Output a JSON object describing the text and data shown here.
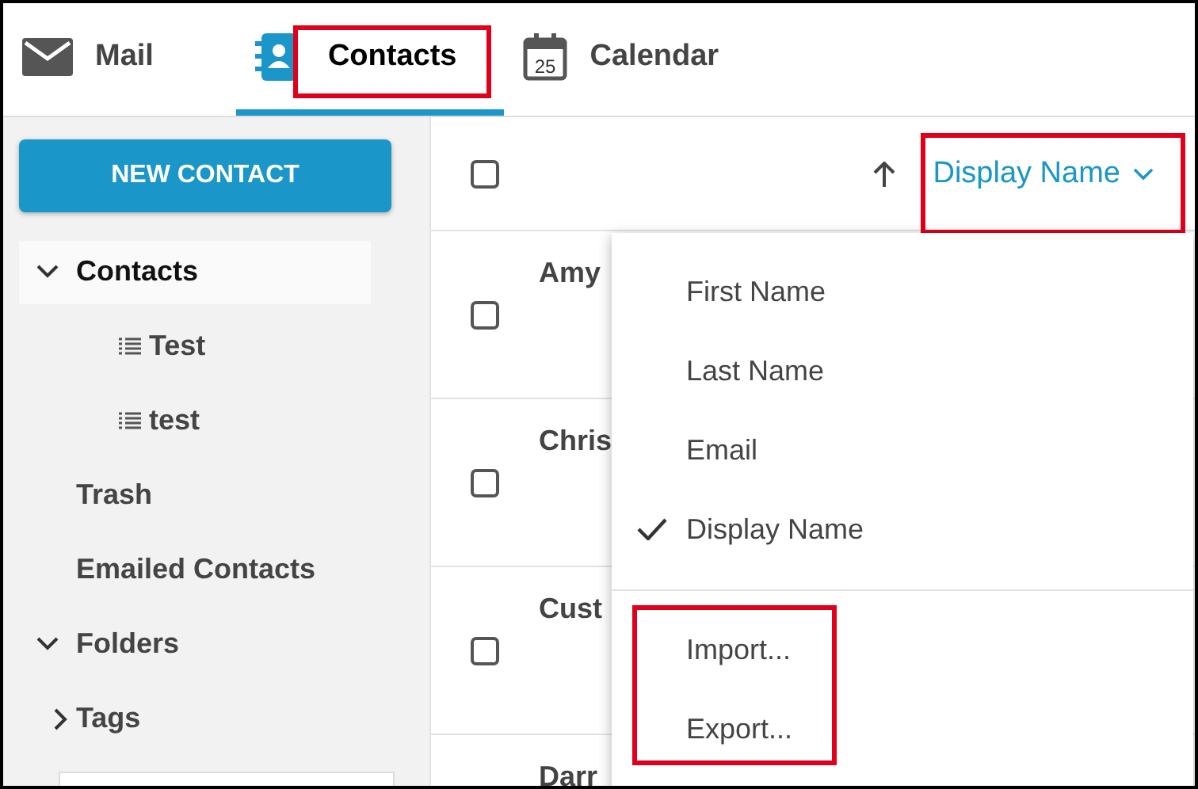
{
  "tabs": [
    {
      "label": "Mail",
      "kind": "mail",
      "selected": false,
      "highlighted": false
    },
    {
      "label": "Contacts",
      "kind": "contacts",
      "selected": true,
      "highlighted": true
    },
    {
      "label": "Calendar",
      "kind": "calendar",
      "icon_text": "25",
      "selected": false,
      "highlighted": false
    }
  ],
  "new_contact_button": "NEW CONTACT",
  "sidebar": {
    "items": [
      {
        "label": "Contacts",
        "kind": "folder",
        "expanded": true,
        "selected": true,
        "children": [
          {
            "label": "Test",
            "kind": "list",
            "selected": false
          },
          {
            "label": "test",
            "kind": "list",
            "selected": false
          }
        ]
      },
      {
        "label": "Trash",
        "kind": "plain",
        "selected": false
      },
      {
        "label": "Emailed Contacts",
        "kind": "plain",
        "selected": false
      },
      {
        "label": "Folders",
        "kind": "folder",
        "expanded": true,
        "selected": false
      },
      {
        "label": "Tags",
        "kind": "folder",
        "expanded": false,
        "selected": false
      }
    ]
  },
  "list_header": {
    "select_all_checked": false,
    "sort_field": "Display Name",
    "sort_highlighted": true
  },
  "contacts": [
    {
      "name": "Amy",
      "checked": false
    },
    {
      "name": "Chris",
      "checked": false
    },
    {
      "name": "Cust",
      "checked": false
    },
    {
      "name": "Darr"
    }
  ],
  "sort_menu": {
    "sort_items": [
      {
        "label": "First Name",
        "selected": false
      },
      {
        "label": "Last Name",
        "selected": false
      },
      {
        "label": "Email",
        "selected": false
      },
      {
        "label": "Display Name",
        "selected": true
      }
    ],
    "actions": [
      {
        "label": "Import..."
      },
      {
        "label": "Export..."
      }
    ],
    "actions_highlighted": true
  }
}
